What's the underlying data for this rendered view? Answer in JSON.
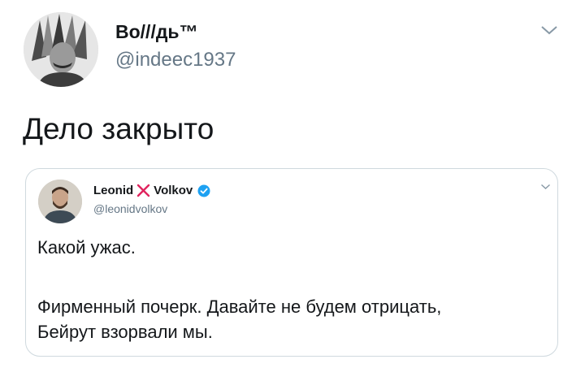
{
  "tweet": {
    "author": {
      "name": "Во///дь™",
      "handle": "@indeec1937"
    },
    "text": "Дело закрыто",
    "quoted": {
      "author": {
        "first_name": "Leonid",
        "last_name": "Volkov",
        "handle": "@leonidvolkov",
        "verified": true
      },
      "lines": [
        "Какой ужас.",
        "Фирменный почерк. Давайте не будем отрицать,",
        "Бейрут взорвали мы."
      ]
    }
  },
  "colors": {
    "text": "#14171a",
    "secondary": "#657786",
    "verified_badge": "#1da1f2",
    "x_mark": "#e0245e",
    "card_border": "#cfd9de"
  },
  "icons": {
    "menu": "chevron-down-icon",
    "quote_menu": "chevron-down-icon",
    "name_separator": "x-mark-icon",
    "verified": "verified-badge-icon"
  }
}
